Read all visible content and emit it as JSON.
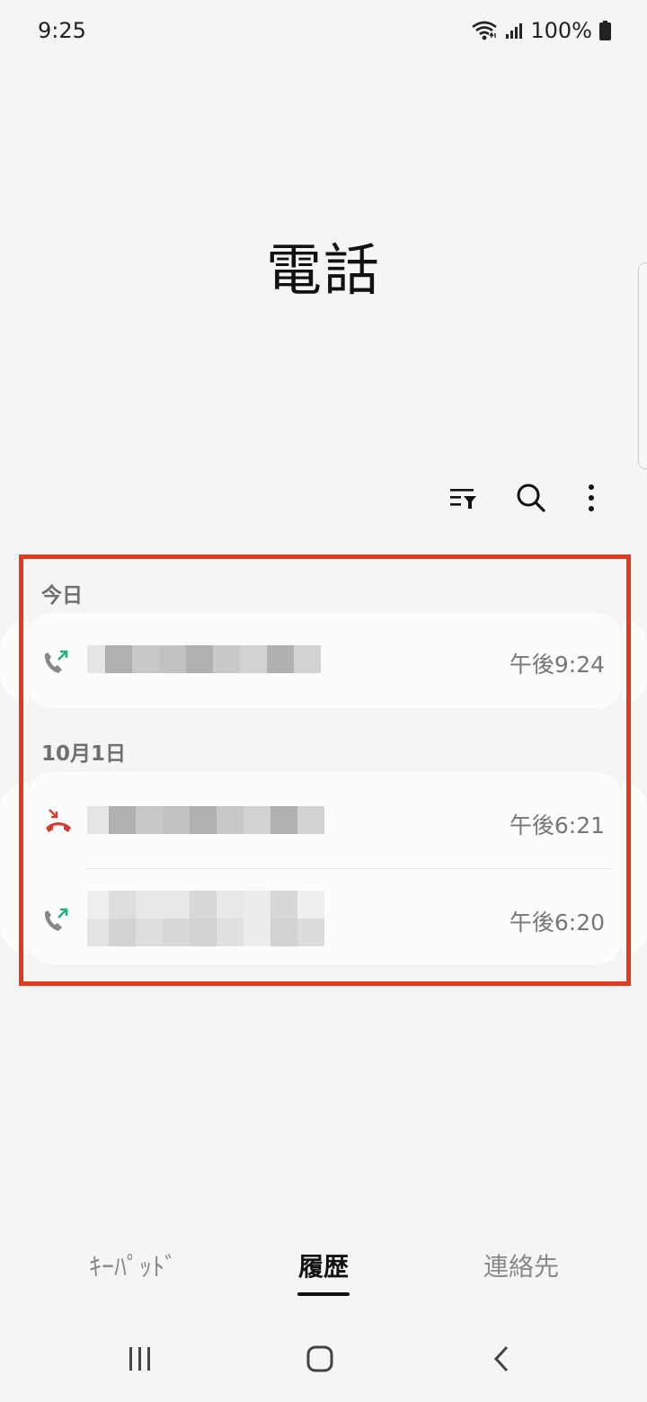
{
  "status_bar": {
    "time": "9:25",
    "battery": "100%"
  },
  "app": {
    "title": "電話"
  },
  "toolbar": {
    "filter_icon": "filter-icon",
    "search_icon": "search-icon",
    "more_icon": "more-vert-icon"
  },
  "sections": [
    {
      "header": "今日",
      "calls": [
        {
          "type": "outgoing",
          "time": "午後9:24"
        }
      ]
    },
    {
      "header": "10月1日",
      "calls": [
        {
          "type": "rejected",
          "time": "午後6:21"
        },
        {
          "type": "outgoing",
          "time": "午後6:20"
        }
      ]
    }
  ],
  "bottom_tabs": [
    {
      "label": "ｷｰﾊﾟｯﾄﾞ",
      "active": false
    },
    {
      "label": "履歴",
      "active": true
    },
    {
      "label": "連絡先",
      "active": false
    }
  ],
  "colors": {
    "highlight": "#e43a1c",
    "outgoing_arrow": "#27b27a",
    "rejected": "#d63a2f"
  }
}
